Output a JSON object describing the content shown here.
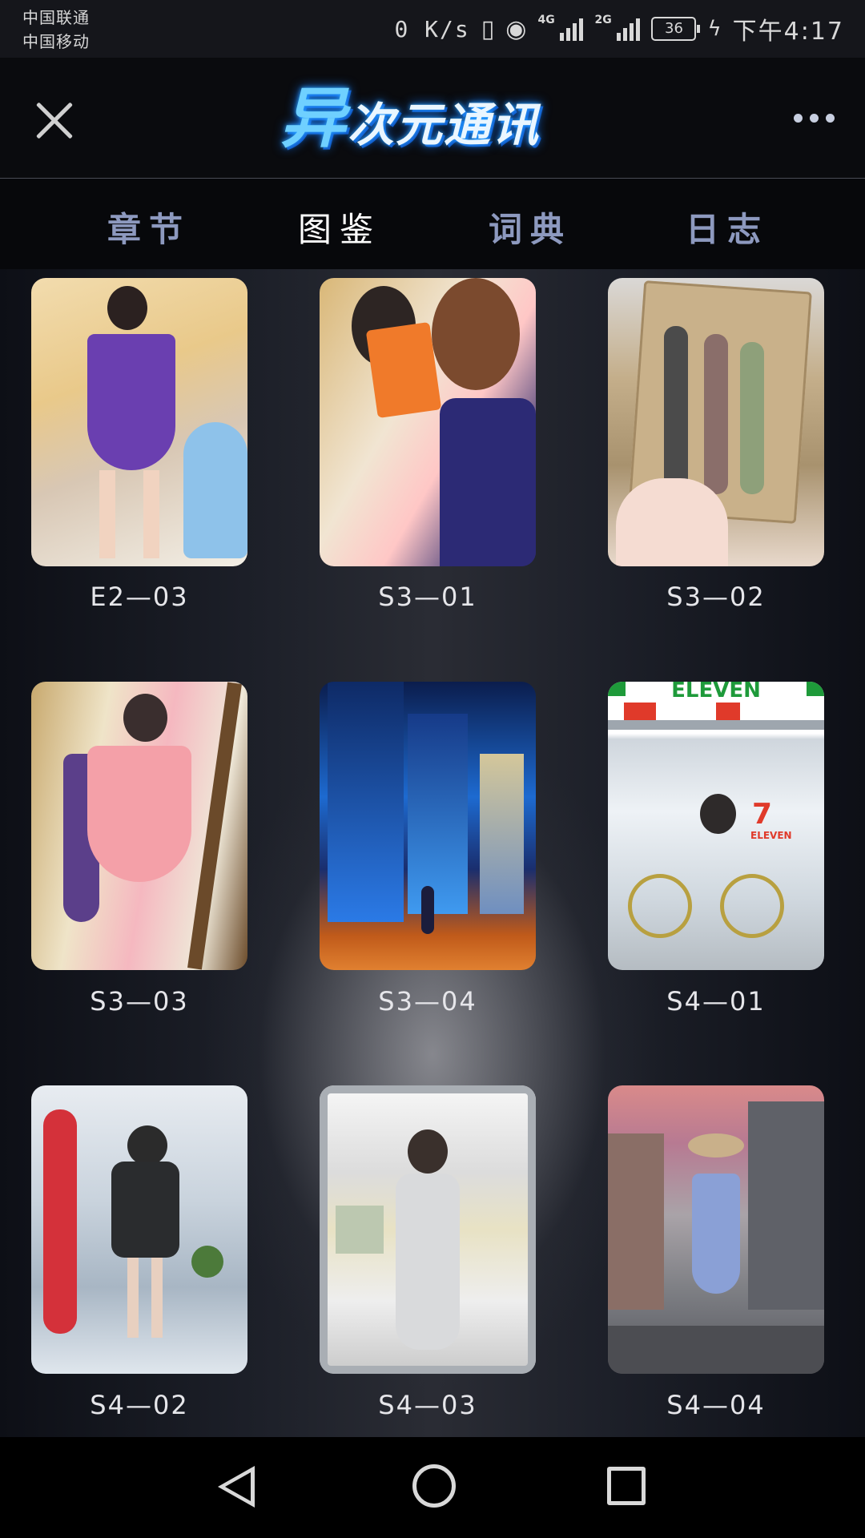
{
  "status_bar": {
    "carrier1": "中国联通",
    "carrier2": "中国移动",
    "speed": "0 K/s",
    "net1": "4G",
    "net2": "2G",
    "battery": "36",
    "time": "下午4:17"
  },
  "header": {
    "logo": "异次元通讯",
    "close_icon": "close-icon",
    "more_icon": "more-dots-icon"
  },
  "tabs": [
    {
      "label": "章节",
      "active": false
    },
    {
      "label": "图鉴",
      "active": true
    },
    {
      "label": "词典",
      "active": false
    },
    {
      "label": "日志",
      "active": false
    }
  ],
  "gallery": [
    {
      "label": "E2—03"
    },
    {
      "label": "S3—01"
    },
    {
      "label": "S3—02"
    },
    {
      "label": "S3—03"
    },
    {
      "label": "S3—04"
    },
    {
      "label": "S4—01"
    },
    {
      "label": "S4—02"
    },
    {
      "label": "S4—03"
    },
    {
      "label": "S4—04"
    }
  ],
  "image_text": {
    "store_sign": "ELEVEN",
    "store_logo": "7",
    "store_logo_text": "ELEVEN"
  },
  "navbar": {
    "back": "back-triangle-icon",
    "home": "home-circle-icon",
    "recent": "recent-square-icon"
  }
}
